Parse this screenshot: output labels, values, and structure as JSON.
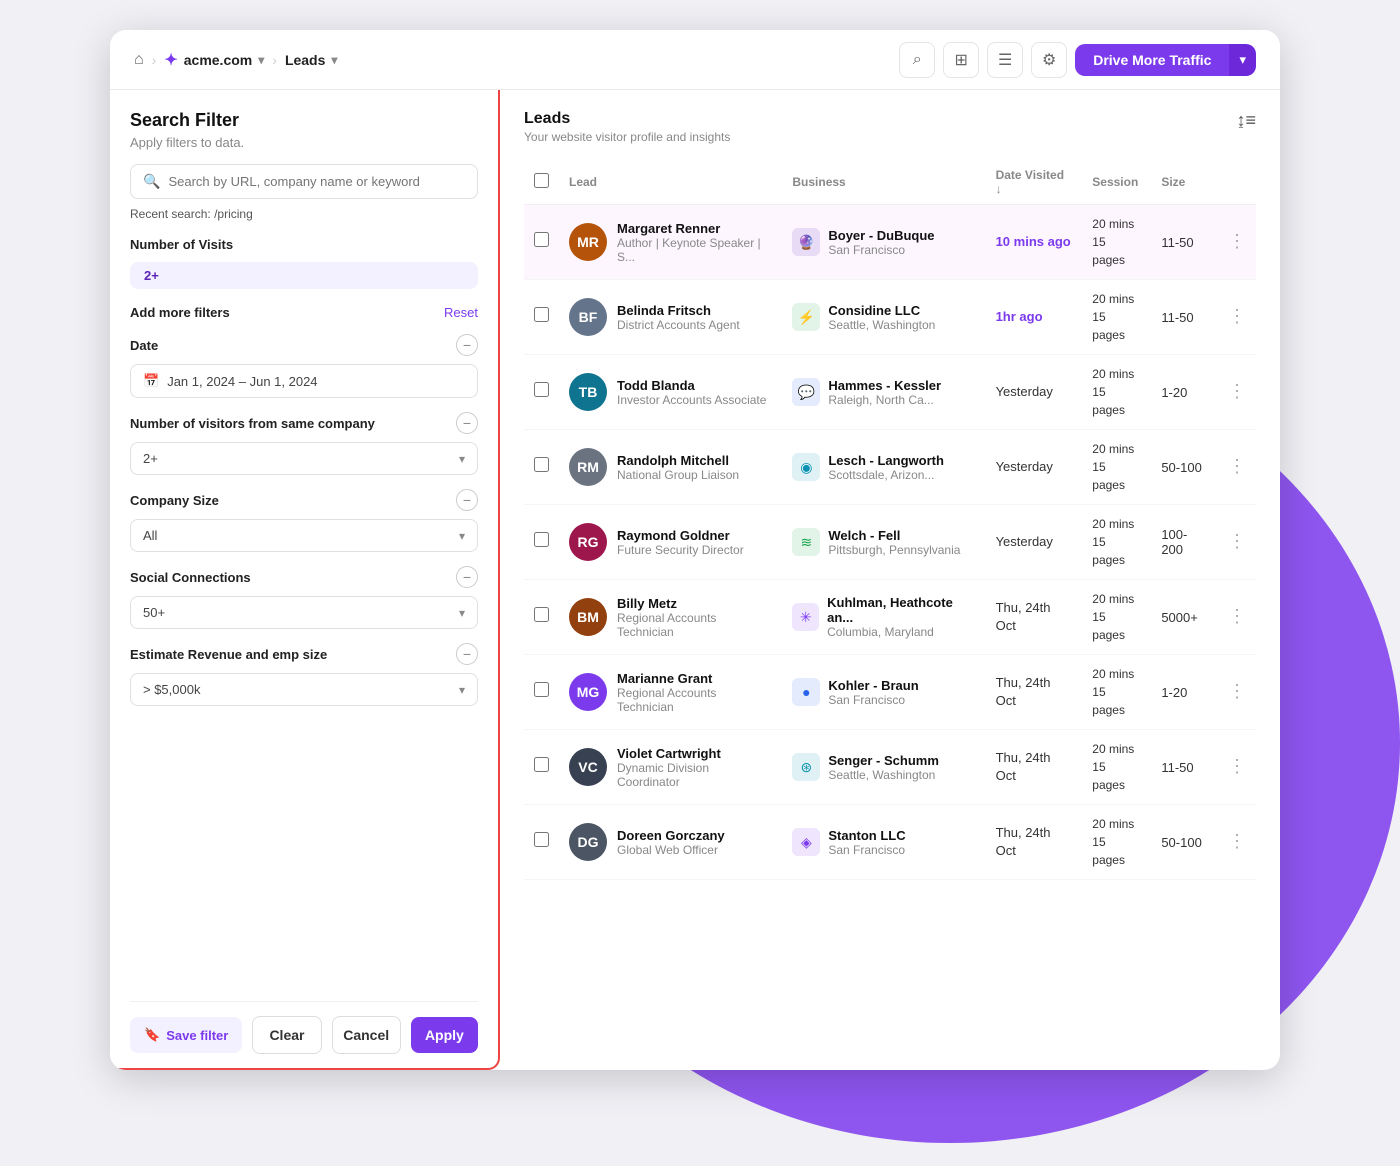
{
  "nav": {
    "home_icon": "⌂",
    "brand_name": "acme.com",
    "brand_icon": "✦",
    "separator": "›",
    "leads_label": "Leads",
    "chevron": "▾",
    "drive_traffic_label": "Drive More Traffic",
    "search_icon": "⌕",
    "grid_icon": "⊞",
    "list_icon": "☰",
    "gear_icon": "⚙"
  },
  "filter": {
    "title": "Search Filter",
    "subtitle": "Apply filters to data.",
    "search_placeholder": "Search by URL, company name or keyword",
    "search_icon": "🔍",
    "recent_label": "Recent search:",
    "recent_value": "/pricing",
    "visits_section": "Number of Visits",
    "visits_value": "2+",
    "add_filters_label": "Add more filters",
    "reset_label": "Reset",
    "date_section": "Date",
    "date_value": "Jan 1, 2024 – Jun 1, 2024",
    "date_icon": "📅",
    "visitors_section": "Number of visitors from same company",
    "visitors_value": "2+",
    "company_size_section": "Company Size",
    "company_size_value": "All",
    "social_connections_section": "Social Connections",
    "social_value": "50+",
    "revenue_section": "Estimate Revenue and emp size",
    "revenue_value": "> $5,000k",
    "save_filter_label": "Save filter",
    "clear_label": "Clear",
    "cancel_label": "Cancel",
    "apply_label": "Apply"
  },
  "leads": {
    "title": "Leads",
    "subtitle": "Your website visitor profile and insights",
    "columns": [
      "Lead",
      "Business",
      "Date Visited",
      "Session",
      "Size"
    ],
    "rows": [
      {
        "name": "Margaret Renner",
        "role": "Author | Keynote Speaker | S...",
        "business": "Boyer - DuBuque",
        "city": "San Francisco",
        "biz_color": "#5b21b6",
        "biz_icon": "🔮",
        "date": "10 mins ago",
        "date_highlight": true,
        "session_mins": "20 mins",
        "session_pages": "15 pages",
        "size": "11-50",
        "avatar_color": "#b45309",
        "initials": "MR"
      },
      {
        "name": "Belinda Fritsch",
        "role": "District Accounts Agent",
        "business": "Considine LLC",
        "city": "Seattle, Washington",
        "biz_color": "#16a34a",
        "biz_icon": "⚡",
        "date": "1hr ago",
        "date_highlight": true,
        "session_mins": "20 mins",
        "session_pages": "15 pages",
        "size": "11-50",
        "avatar_color": "#64748b",
        "initials": "BF"
      },
      {
        "name": "Todd Blanda",
        "role": "Investor Accounts Associate",
        "business": "Hammes - Kessler",
        "city": "Raleigh, North Ca...",
        "biz_color": "#2563eb",
        "biz_icon": "💬",
        "date": "Yesterday",
        "date_highlight": false,
        "session_mins": "20 mins",
        "session_pages": "15 pages",
        "size": "1-20",
        "avatar_color": "#0e7490",
        "initials": "TB"
      },
      {
        "name": "Randolph Mitchell",
        "role": "National Group Liaison",
        "business": "Lesch - Langworth",
        "city": "Scottsdale, Arizon...",
        "biz_color": "#0891b2",
        "biz_icon": "◉",
        "date": "Yesterday",
        "date_highlight": false,
        "session_mins": "20 mins",
        "session_pages": "15 pages",
        "size": "50-100",
        "avatar_color": "#6b7280",
        "initials": "RM"
      },
      {
        "name": "Raymond Goldner",
        "role": "Future Security Director",
        "business": "Welch - Fell",
        "city": "Pittsburgh, Pennsylvania",
        "biz_color": "#16a34a",
        "biz_icon": "≋",
        "date": "Yesterday",
        "date_highlight": false,
        "session_mins": "20 mins",
        "session_pages": "15 pages",
        "size": "100-200",
        "avatar_color": "#9d174d",
        "initials": "RG"
      },
      {
        "name": "Billy Metz",
        "role": "Regional Accounts Technician",
        "business": "Kuhlman, Heathcote an...",
        "city": "Columbia, Maryland",
        "biz_color": "#7c3aed",
        "biz_icon": "✳",
        "date": "Thu, 24th Oct",
        "date_highlight": false,
        "session_mins": "20 mins",
        "session_pages": "15 pages",
        "size": "5000+",
        "avatar_color": "#92400e",
        "initials": "BM"
      },
      {
        "name": "Marianne Grant",
        "role": "Regional Accounts Technician",
        "business": "Kohler - Braun",
        "city": "San Francisco",
        "biz_color": "#2563eb",
        "biz_icon": "●",
        "date": "Thu, 24th Oct",
        "date_highlight": false,
        "session_mins": "20 mins",
        "session_pages": "15 pages",
        "size": "1-20",
        "avatar_color": "#7c3aed",
        "initials": "MG"
      },
      {
        "name": "Violet Cartwright",
        "role": "Dynamic Division Coordinator",
        "business": "Senger - Schumm",
        "city": "Seattle, Washington",
        "biz_color": "#0891b2",
        "biz_icon": "⊛",
        "date": "Thu, 24th Oct",
        "date_highlight": false,
        "session_mins": "20 mins",
        "session_pages": "15 pages",
        "size": "11-50",
        "avatar_color": "#374151",
        "initials": "VC"
      },
      {
        "name": "Doreen Gorczany",
        "role": "Global Web Officer",
        "business": "Stanton LLC",
        "city": "San Francisco",
        "biz_color": "#7c3aed",
        "biz_icon": "◈",
        "date": "Thu, 24th Oct",
        "date_highlight": false,
        "session_mins": "20 mins",
        "session_pages": "15 pages",
        "size": "50-100",
        "avatar_color": "#4b5563",
        "initials": "DG"
      }
    ]
  }
}
